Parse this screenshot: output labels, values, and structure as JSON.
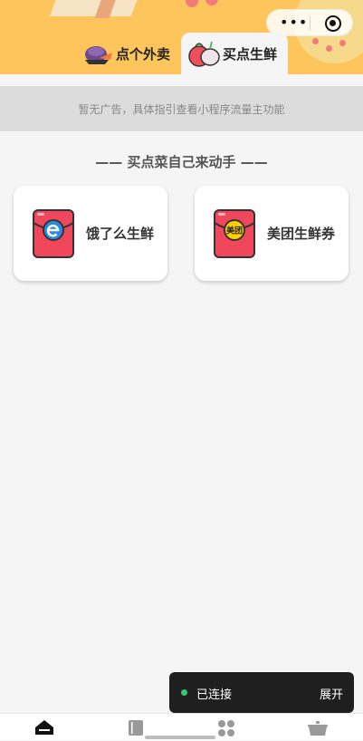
{
  "tabs": [
    {
      "label": "点个外卖",
      "icon": "takeout-food-icon"
    },
    {
      "label": "买点生鲜",
      "icon": "vegetable-icon",
      "active": true
    }
  ],
  "ad_text": "暂无广告，具体指引查看小程序流量主功能",
  "section_title": "—— 买点菜自己来动手 ——",
  "cards": [
    {
      "label": "饿了么生鲜",
      "icon": "eleme-red-envelope-icon"
    },
    {
      "label": "美团生鲜券",
      "icon": "meituan-red-envelope-icon",
      "badge_text": "美团"
    }
  ],
  "toast": {
    "status": "已连接",
    "action": "展开"
  },
  "bottom_nav": [
    {
      "icon": "home-icon",
      "active": true
    },
    {
      "icon": "book-icon"
    },
    {
      "icon": "grid-icon"
    },
    {
      "icon": "pot-icon"
    }
  ],
  "colors": {
    "header": "#fdc55b",
    "envelope": "#f1475c",
    "toast_dot": "#2ecc71"
  }
}
